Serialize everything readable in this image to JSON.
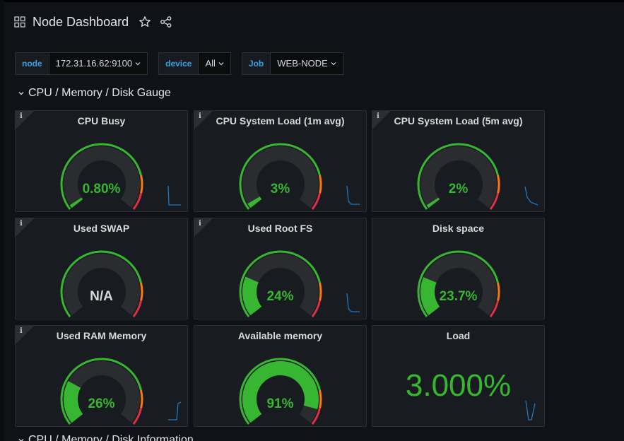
{
  "header": {
    "title": "Node Dashboard",
    "icons": [
      "apps-icon",
      "star-icon",
      "share-icon"
    ]
  },
  "variables": [
    {
      "label": "node",
      "value": "172.31.16.62:9100"
    },
    {
      "label": "device",
      "value": "All"
    },
    {
      "label": "Job",
      "value": "WEB-NODE"
    }
  ],
  "rows": {
    "gauge_row": "CPU / Memory / Disk Gauge",
    "info_row": "CPU / Memory / Disk Information"
  },
  "colors": {
    "green": "#37b631",
    "orange": "#ff780a",
    "red": "#e02f44",
    "track": "#2a2c30",
    "spark": "#1f78c1",
    "var_label": "#33a2e5"
  },
  "panels": [
    {
      "title": "CPU Busy",
      "value": "0.80%",
      "fraction": 0.008,
      "info": true,
      "spark": true
    },
    {
      "title": "CPU System Load (1m avg)",
      "value": "3%",
      "fraction": 0.03,
      "info": true,
      "spark": true
    },
    {
      "title": "CPU System Load (5m avg)",
      "value": "2%",
      "fraction": 0.02,
      "info": true,
      "spark": true
    },
    {
      "title": "Used SWAP",
      "value": "N/A",
      "fraction": null,
      "info": true,
      "spark": false
    },
    {
      "title": "Used Root FS",
      "value": "24%",
      "fraction": 0.24,
      "info": true,
      "spark": true
    },
    {
      "title": "Disk space",
      "value": "23.7%",
      "fraction": 0.237,
      "info": false,
      "spark": false
    },
    {
      "title": "Used RAM Memory",
      "value": "26%",
      "fraction": 0.26,
      "info": true,
      "spark": true
    },
    {
      "title": "Available memory",
      "value": "91%",
      "fraction": 0.91,
      "info": false,
      "spark": false
    },
    {
      "title": "Load",
      "value": "3.000%",
      "fraction": null,
      "info": false,
      "spark": true,
      "stat": true
    }
  ]
}
